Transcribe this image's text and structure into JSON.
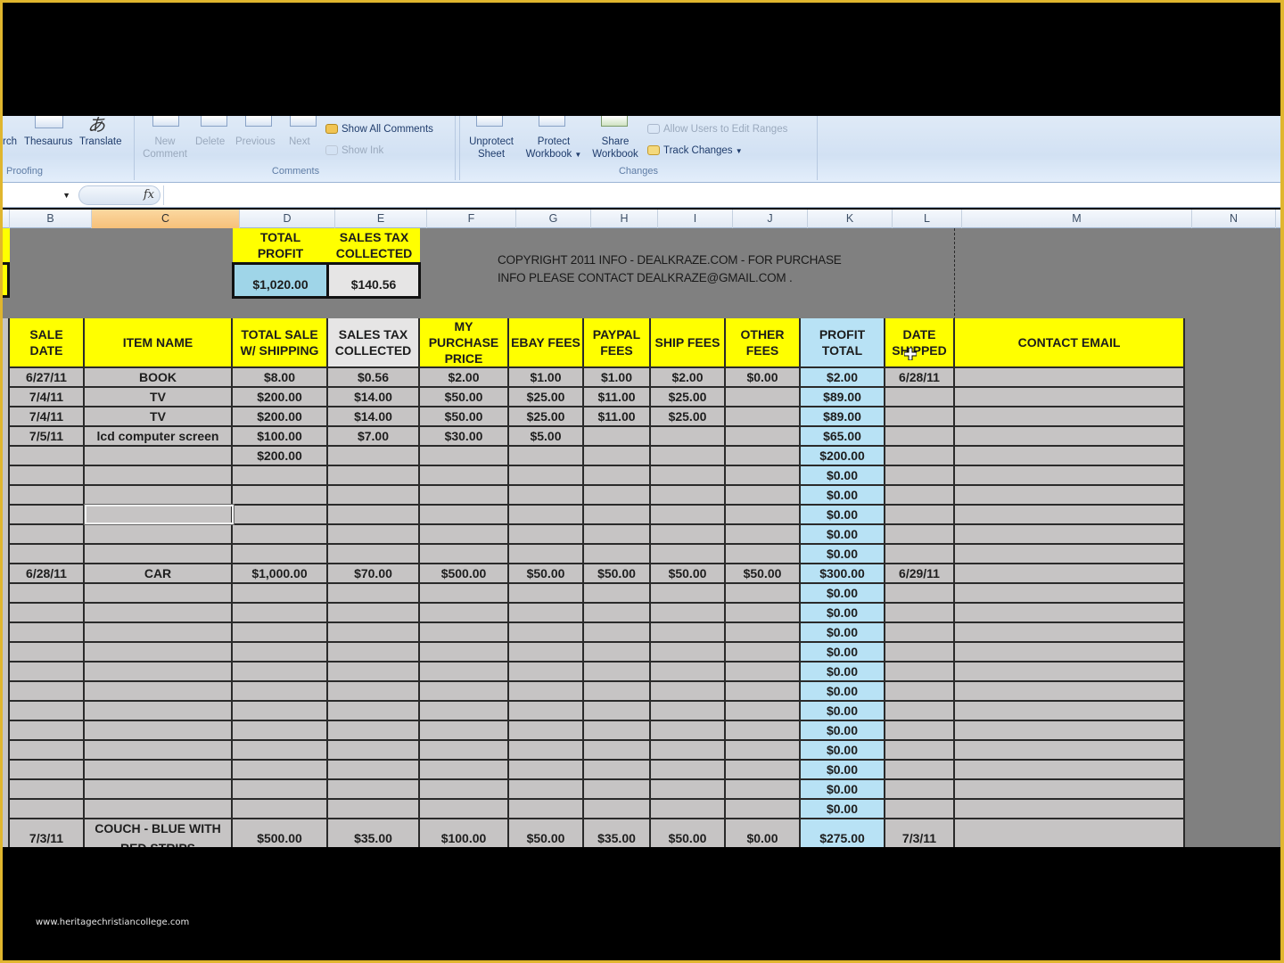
{
  "ribbon": {
    "proofing": {
      "group_label": "Proofing",
      "buttons": [
        {
          "label": "rch",
          "icon": "research-icon"
        },
        {
          "label": "Thesaurus",
          "icon": "thesaurus-icon"
        },
        {
          "label": "Translate",
          "icon": "translate-icon"
        }
      ]
    },
    "comments": {
      "group_label": "Comments",
      "new_comment": "New\nComment",
      "new_comment_l1": "New",
      "new_comment_l2": "Comment",
      "delete": "Delete",
      "previous": "Previous",
      "next": "Next",
      "show_all_comments": "Show All Comments",
      "show_ink": "Show Ink"
    },
    "changes": {
      "group_label": "Changes",
      "unprotect_l1": "Unprotect",
      "unprotect_l2": "Sheet",
      "protect_l1": "Protect",
      "protect_l2": "Workbook",
      "share_l1": "Share",
      "share_l2": "Workbook",
      "allow_users": "Allow Users to Edit Ranges",
      "track_changes": "Track Changes"
    }
  },
  "formula_bar": {
    "name_box": "",
    "fx_label": "fx",
    "formula": ""
  },
  "columns": [
    "B",
    "C",
    "D",
    "E",
    "F",
    "G",
    "H",
    "I",
    "J",
    "K",
    "L",
    "M",
    "N"
  ],
  "selected_column": "C",
  "summary": {
    "total_profit_label": "TOTAL PROFIT",
    "total_profit_l1": "TOTAL",
    "total_profit_l2": "PROFIT",
    "total_profit_value": "$1,020.00",
    "sales_tax_l1": "SALES TAX",
    "sales_tax_l2": "COLLECTED",
    "sales_tax_value": "$140.56"
  },
  "copyright": {
    "line1": "COPYRIGHT  2011 INFO -   DEALKRAZE.COM - FOR PURCHASE",
    "line2": "INFO PLEASE CONTACT DEALKRAZE@GMAIL.COM ."
  },
  "table": {
    "headers": [
      {
        "l1": "SALE",
        "l2": "DATE",
        "l3": ""
      },
      {
        "l1": "ITEM NAME",
        "l2": "",
        "l3": ""
      },
      {
        "l1": "TOTAL SALE",
        "l2": "W/ SHIPPING",
        "l3": ""
      },
      {
        "l1": "SALES TAX",
        "l2": "COLLECTED",
        "l3": ""
      },
      {
        "l1": "MY",
        "l2": "PURCHASE",
        "l3": "PRICE"
      },
      {
        "l1": "EBAY FEES",
        "l2": "",
        "l3": ""
      },
      {
        "l1": "PAYPAL",
        "l2": "FEES",
        "l3": ""
      },
      {
        "l1": "SHIP FEES",
        "l2": "",
        "l3": ""
      },
      {
        "l1": "OTHER",
        "l2": "FEES",
        "l3": ""
      },
      {
        "l1": "PROFIT",
        "l2": "TOTAL",
        "l3": ""
      },
      {
        "l1": "DATE",
        "l2": "SHIPPED",
        "l3": ""
      },
      {
        "l1": "CONTACT EMAIL",
        "l2": "",
        "l3": ""
      }
    ],
    "rows": [
      [
        "6/27/11",
        "BOOK",
        "$8.00",
        "$0.56",
        "$2.00",
        "$1.00",
        "$1.00",
        "$2.00",
        "$0.00",
        "$2.00",
        "6/28/11",
        ""
      ],
      [
        "7/4/11",
        "TV",
        "$200.00",
        "$14.00",
        "$50.00",
        "$25.00",
        "$11.00",
        "$25.00",
        "",
        "$89.00",
        "",
        ""
      ],
      [
        "7/4/11",
        "TV",
        "$200.00",
        "$14.00",
        "$50.00",
        "$25.00",
        "$11.00",
        "$25.00",
        "",
        "$89.00",
        "",
        ""
      ],
      [
        "7/5/11",
        "lcd computer screen",
        "$100.00",
        "$7.00",
        "$30.00",
        "$5.00",
        "",
        "",
        "",
        "$65.00",
        "",
        ""
      ],
      [
        "",
        "",
        "$200.00",
        "",
        "",
        "",
        "",
        "",
        "",
        "$200.00",
        "",
        ""
      ],
      [
        "",
        "",
        "",
        "",
        "",
        "",
        "",
        "",
        "",
        "$0.00",
        "",
        ""
      ],
      [
        "",
        "",
        "",
        "",
        "",
        "",
        "",
        "",
        "",
        "$0.00",
        "",
        ""
      ],
      [
        "",
        "",
        "",
        "",
        "",
        "",
        "",
        "",
        "",
        "$0.00",
        "",
        ""
      ],
      [
        "",
        "",
        "",
        "",
        "",
        "",
        "",
        "",
        "",
        "$0.00",
        "",
        ""
      ],
      [
        "",
        "",
        "",
        "",
        "",
        "",
        "",
        "",
        "",
        "$0.00",
        "",
        ""
      ],
      [
        "6/28/11",
        "CAR",
        "$1,000.00",
        "$70.00",
        "$500.00",
        "$50.00",
        "$50.00",
        "$50.00",
        "$50.00",
        "$300.00",
        "6/29/11",
        ""
      ],
      [
        "",
        "",
        "",
        "",
        "",
        "",
        "",
        "",
        "",
        "$0.00",
        "",
        ""
      ],
      [
        "",
        "",
        "",
        "",
        "",
        "",
        "",
        "",
        "",
        "$0.00",
        "",
        ""
      ],
      [
        "",
        "",
        "",
        "",
        "",
        "",
        "",
        "",
        "",
        "$0.00",
        "",
        ""
      ],
      [
        "",
        "",
        "",
        "",
        "",
        "",
        "",
        "",
        "",
        "$0.00",
        "",
        ""
      ],
      [
        "",
        "",
        "",
        "",
        "",
        "",
        "",
        "",
        "",
        "$0.00",
        "",
        ""
      ],
      [
        "",
        "",
        "",
        "",
        "",
        "",
        "",
        "",
        "",
        "$0.00",
        "",
        ""
      ],
      [
        "",
        "",
        "",
        "",
        "",
        "",
        "",
        "",
        "",
        "$0.00",
        "",
        ""
      ],
      [
        "",
        "",
        "",
        "",
        "",
        "",
        "",
        "",
        "",
        "$0.00",
        "",
        ""
      ],
      [
        "",
        "",
        "",
        "",
        "",
        "",
        "",
        "",
        "",
        "$0.00",
        "",
        ""
      ],
      [
        "",
        "",
        "",
        "",
        "",
        "",
        "",
        "",
        "",
        "$0.00",
        "",
        ""
      ],
      [
        "",
        "",
        "",
        "",
        "",
        "",
        "",
        "",
        "",
        "$0.00",
        "",
        ""
      ],
      [
        "",
        "",
        "",
        "",
        "",
        "",
        "",
        "",
        "",
        "$0.00",
        "",
        ""
      ],
      [
        "7/3/11",
        "COUCH - BLUE WITH RED STRIPS",
        "$500.00",
        "$35.00",
        "$100.00",
        "$50.00",
        "$35.00",
        "$50.00",
        "$0.00",
        "$275.00",
        "7/3/11",
        ""
      ]
    ]
  },
  "watermark": "www.heritagechristiancollege.com"
}
